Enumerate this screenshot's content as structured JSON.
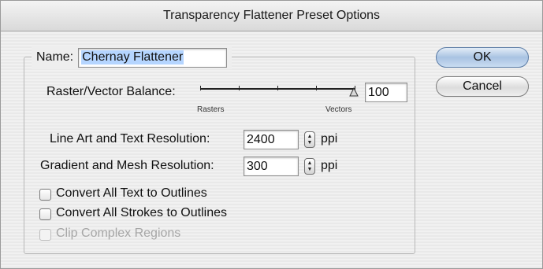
{
  "window": {
    "title": "Transparency Flattener Preset Options"
  },
  "name_field": {
    "label": "Name:",
    "value": "Chernay Flattener"
  },
  "buttons": {
    "ok": "OK",
    "cancel": "Cancel"
  },
  "raster_vector": {
    "label": "Raster/Vector Balance:",
    "left_label": "Rasters",
    "right_label": "Vectors",
    "value": "100",
    "slider_fraction": 1.0
  },
  "line_art": {
    "label": "Line Art and Text Resolution:",
    "value": "2400",
    "unit": "ppi"
  },
  "gradient": {
    "label": "Gradient and Mesh Resolution:",
    "value": "300",
    "unit": "ppi"
  },
  "checkboxes": [
    {
      "label": "Convert All Text to Outlines",
      "checked": false,
      "enabled": true
    },
    {
      "label": "Convert All Strokes to Outlines",
      "checked": false,
      "enabled": true
    },
    {
      "label": "Clip Complex Regions",
      "checked": false,
      "enabled": false
    }
  ],
  "colors": {
    "selection": "#b5d5ff",
    "default_button": "#a9c3e2"
  }
}
